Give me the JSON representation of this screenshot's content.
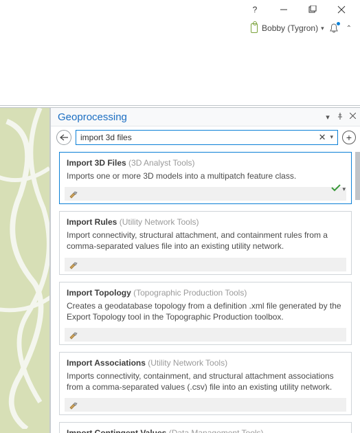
{
  "window_controls": {
    "help": "?",
    "min": "—",
    "max": "▭",
    "close": "✕"
  },
  "user": {
    "name": "Bobby (Tygron)"
  },
  "panel": {
    "title": "Geoprocessing"
  },
  "search": {
    "value": "import 3d files"
  },
  "results": [
    {
      "tool": "Import 3D Files",
      "category": "(3D Analyst Tools)",
      "desc": "Imports one or more 3D models into a multipatch feature class.",
      "selected": true,
      "has_status": true
    },
    {
      "tool": "Import Rules",
      "category": "(Utility Network Tools)",
      "desc": "Import connectivity, structural attachment, and containment rules from a comma-separated values file into an existing utility network.",
      "selected": false,
      "has_status": false
    },
    {
      "tool": "Import Topology",
      "category": "(Topographic Production Tools)",
      "desc": "Creates a geodatabase topology from a definition .xml file generated by the Export Topology tool in the Topographic Production toolbox.",
      "selected": false,
      "has_status": false
    },
    {
      "tool": "Import Associations",
      "category": "(Utility Network Tools)",
      "desc": "Imports connectivity, containment, and structural attachment associations from a comma-separated values (.csv) file into an existing utility network.",
      "selected": false,
      "has_status": false
    },
    {
      "tool": "Import Contingent Values",
      "category": "(Data Management Tools)",
      "desc": "",
      "selected": false,
      "has_status": false,
      "partial": true
    }
  ]
}
